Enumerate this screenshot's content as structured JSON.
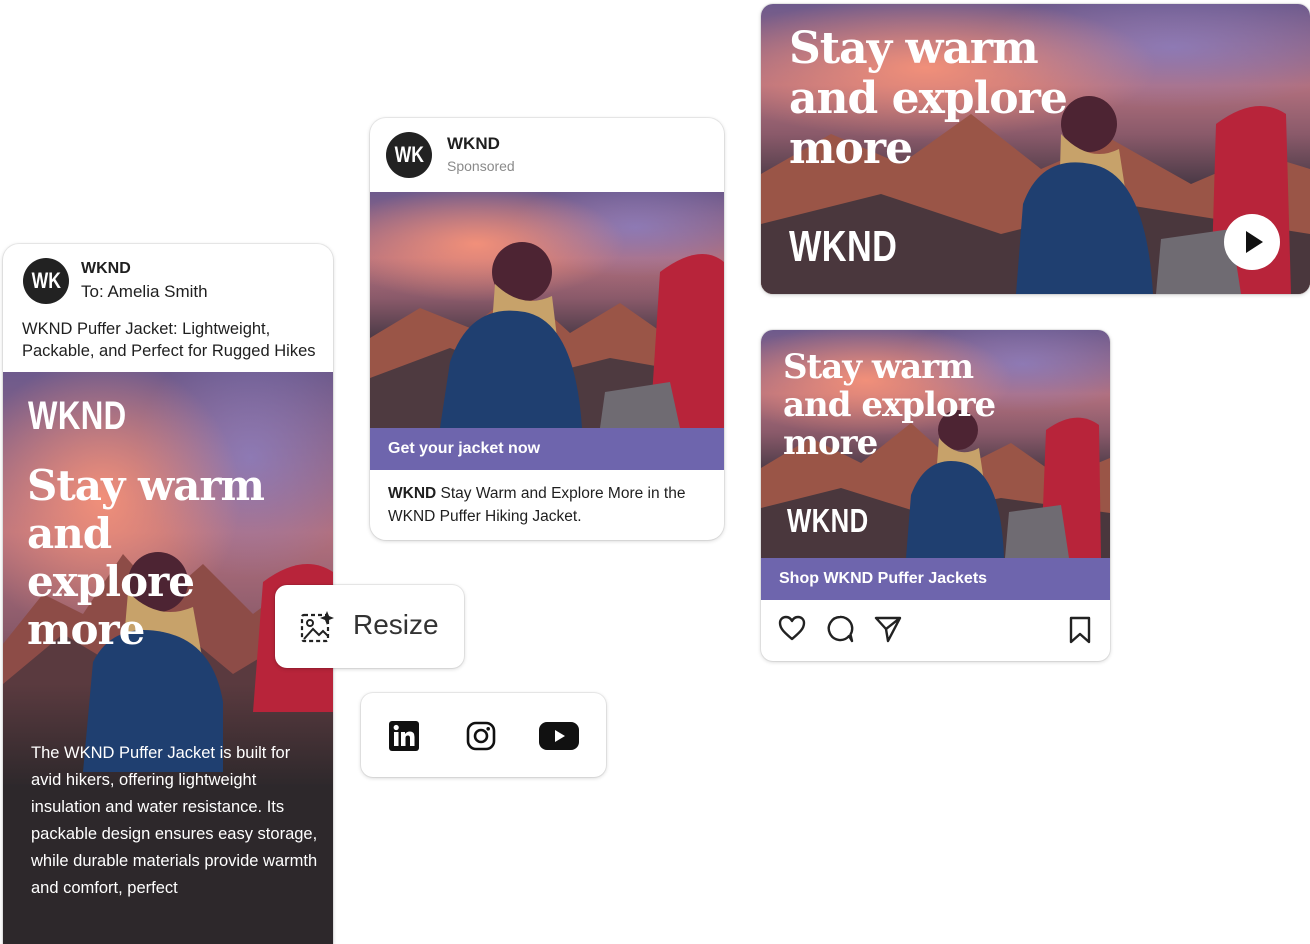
{
  "email_card": {
    "avatar_initials": "WK",
    "brand": "WKND",
    "to_line": "To: Amelia Smith",
    "subject": "WKND Puffer Jacket: Lightweight, Packable, and Perfect for Rugged Hikes",
    "hero_brand": "WKND",
    "headline": "Stay warm and explore more",
    "body": "The WKND Puffer Jacket is built for avid hikers, offering lightweight insulation and water resistance. Its packable design ensures easy storage, while durable materials provide warmth and comfort, perfect"
  },
  "sponsored_card": {
    "avatar_initials": "WK",
    "brand": "WKND",
    "sponsored_label": "Sponsored",
    "cta": "Get your jacket now",
    "caption_brand": "WKND",
    "caption_text": " Stay Warm and Explore More in the WKND Puffer Hiking Jacket."
  },
  "resize_button": {
    "label": "Resize",
    "icon": "resize-ai-icon"
  },
  "social_channels": {
    "icons": [
      "linkedin-icon",
      "instagram-icon",
      "youtube-icon"
    ]
  },
  "video_banner": {
    "headline": "Stay warm and explore more",
    "brand": "WKND",
    "icon": "play-icon"
  },
  "instagram_card": {
    "headline": "Stay warm and explore more",
    "brand": "WKND",
    "cta": "Shop WKND Puffer Jackets",
    "icons": [
      "heart-icon",
      "comment-icon",
      "share-icon",
      "bookmark-icon"
    ]
  },
  "colors": {
    "accent": "#6e65ad",
    "dark": "#2d282b",
    "text": "#1f1f1f",
    "muted": "#8a8a8a"
  }
}
